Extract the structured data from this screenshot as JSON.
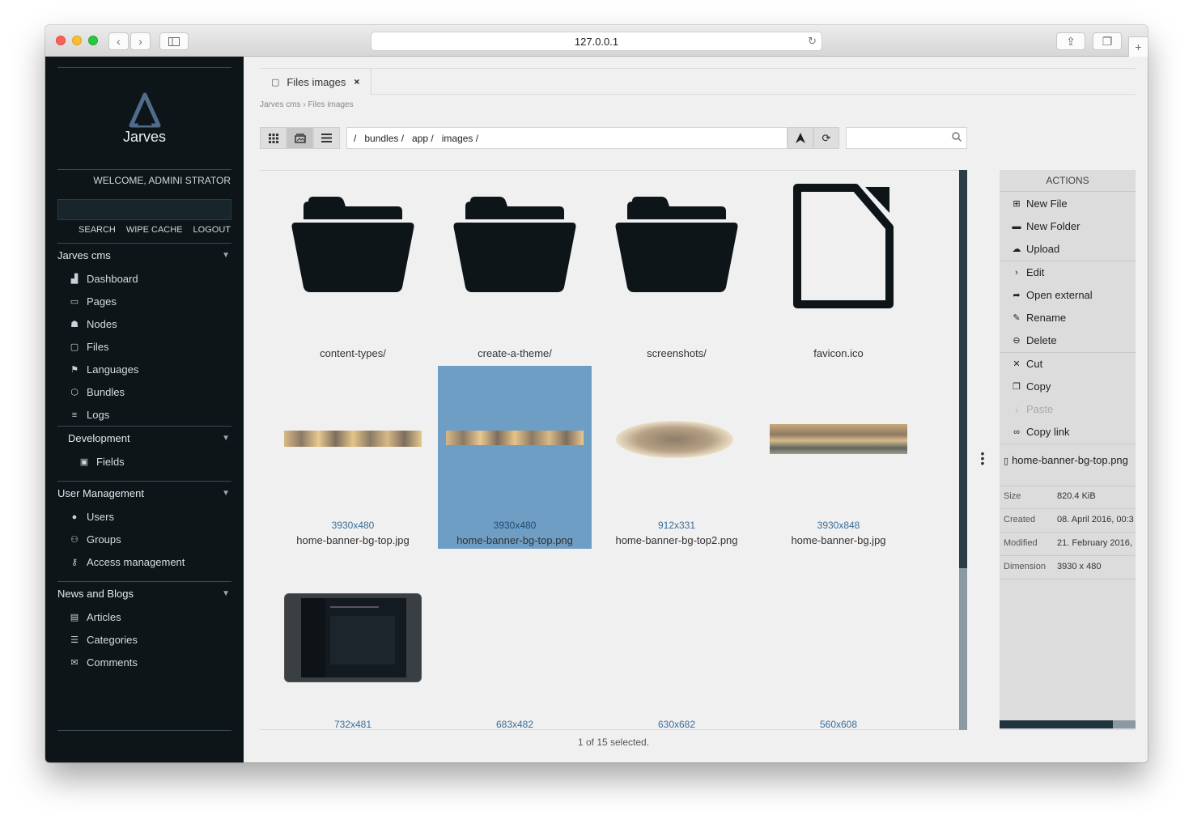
{
  "browser": {
    "url": "127.0.0.1"
  },
  "sidebar": {
    "logo_text": "Jarves",
    "welcome": "WELCOME, ADMINI STRATOR",
    "links": [
      "SEARCH",
      "WIPE CACHE",
      "LOGOUT"
    ],
    "sections": [
      {
        "title": "Jarves cms",
        "items": [
          {
            "label": "Dashboard",
            "icon": "chart-icon"
          },
          {
            "label": "Pages",
            "icon": "monitor-icon"
          },
          {
            "label": "Nodes",
            "icon": "sitemap-icon"
          },
          {
            "label": "Files",
            "icon": "folder-icon"
          },
          {
            "label": "Languages",
            "icon": "flag-icon"
          },
          {
            "label": "Bundles",
            "icon": "cube-icon"
          },
          {
            "label": "Logs",
            "icon": "list-icon"
          }
        ]
      },
      {
        "title": "Development",
        "items": [
          {
            "label": "Fields",
            "icon": "field-icon"
          }
        ]
      },
      {
        "title": "User Management",
        "items": [
          {
            "label": "Users",
            "icon": "user-icon"
          },
          {
            "label": "Groups",
            "icon": "group-icon"
          },
          {
            "label": "Access management",
            "icon": "key-icon"
          }
        ]
      },
      {
        "title": "News and Blogs",
        "items": [
          {
            "label": "Articles",
            "icon": "article-icon"
          },
          {
            "label": "Categories",
            "icon": "categories-icon"
          },
          {
            "label": "Comments",
            "icon": "comments-icon"
          }
        ]
      }
    ]
  },
  "tab": {
    "label": "Files images",
    "close": "×"
  },
  "breadcrumb": "Jarves cms › Files images",
  "path": [
    "/",
    "bundles /",
    "app /",
    "images /"
  ],
  "files": [
    {
      "name": "content-types/",
      "type": "folder"
    },
    {
      "name": "create-a-theme/",
      "type": "folder"
    },
    {
      "name": "screenshots/",
      "type": "folder"
    },
    {
      "name": "favicon.ico",
      "type": "file"
    },
    {
      "name": "home-banner-bg-top.jpg",
      "dim": "3930x480",
      "type": "image"
    },
    {
      "name": "home-banner-bg-top.png",
      "dim": "3930x480",
      "type": "image",
      "selected": true
    },
    {
      "name": "home-banner-bg-top2.png",
      "dim": "912x331",
      "type": "image"
    },
    {
      "name": "home-banner-bg.jpg",
      "dim": "3930x848",
      "type": "image"
    },
    {
      "dim": "732x481",
      "type": "image"
    },
    {
      "dim": "683x482",
      "type": "image"
    },
    {
      "dim": "630x682",
      "type": "image"
    },
    {
      "dim": "560x608",
      "type": "image"
    }
  ],
  "status": "1 of 15 selected.",
  "actions": {
    "title": "ACTIONS",
    "items": [
      {
        "label": "New File",
        "icon": "new-file-icon"
      },
      {
        "label": "New Folder",
        "icon": "new-folder-icon"
      },
      {
        "label": "Upload",
        "icon": "upload-icon"
      },
      {
        "label": "Edit",
        "icon": "edit-icon"
      },
      {
        "label": "Open external",
        "icon": "share-icon"
      },
      {
        "label": "Rename",
        "icon": "pencil-icon"
      },
      {
        "label": "Delete",
        "icon": "delete-icon"
      },
      {
        "label": "Cut",
        "icon": "cut-icon"
      },
      {
        "label": "Copy",
        "icon": "copy-icon"
      },
      {
        "label": "Paste",
        "icon": "paste-icon",
        "disabled": true
      },
      {
        "label": "Copy link",
        "icon": "link-icon"
      }
    ]
  },
  "info": {
    "name": "home-banner-bg-top.png",
    "size_label": "Size",
    "size": "820.4 KiB",
    "created_label": "Created",
    "created": "08. April 2016, 00:3",
    "modified_label": "Modified",
    "modified": "21. February 2016,",
    "dimension_label": "Dimension",
    "dimension": "3930 x 480"
  },
  "colors": {
    "sidebar_bg": "#0d1519",
    "selection": "#6f9ec4",
    "link": "#3b6d9a"
  }
}
